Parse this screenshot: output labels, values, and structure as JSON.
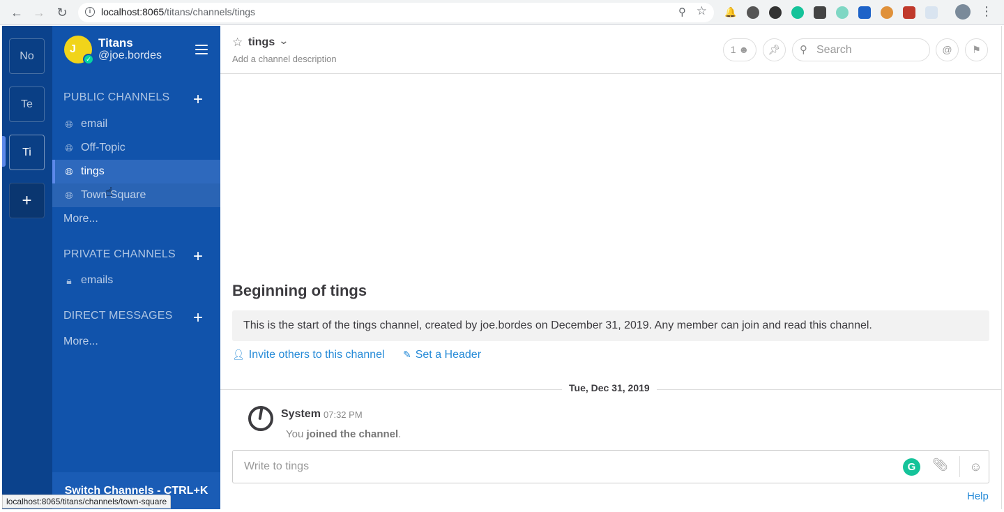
{
  "browser": {
    "url_host": "localhost:8065",
    "url_path": "/titans/channels/tings",
    "status_url": "localhost:8065/titans/channels/town-square"
  },
  "teams": [
    {
      "label": "No",
      "active": false
    },
    {
      "label": "Te",
      "active": false
    },
    {
      "label": "Ti",
      "active": true
    },
    {
      "label": "+",
      "active": false
    }
  ],
  "sidebar": {
    "avatar_initial": "J",
    "team_name": "Titans",
    "username": "@joe.bordes",
    "public_title": "PUBLIC CHANNELS",
    "public_channels": [
      {
        "label": "email",
        "active": false
      },
      {
        "label": "Off-Topic",
        "active": false
      },
      {
        "label": "tings",
        "active": true
      },
      {
        "label": "Town Square",
        "active": false
      }
    ],
    "public_more": "More...",
    "private_title": "PRIVATE CHANNELS",
    "private_channels": [
      {
        "label": "emails"
      }
    ],
    "dm_title": "DIRECT MESSAGES",
    "dm_more": "More...",
    "switch_label": "Switch Channels - CTRL+K"
  },
  "channel": {
    "name": "tings",
    "description_placeholder": "Add a channel description",
    "member_count": "1",
    "search_placeholder": "Search"
  },
  "intro": {
    "title": "Beginning of tings",
    "text": "This is the start of the tings channel, created by joe.bordes on December 31, 2019. Any member can join and read this channel.",
    "invite_label": "Invite others to this channel",
    "header_label": "Set a Header"
  },
  "posts": {
    "date_separator": "Tue, Dec 31, 2019",
    "items": [
      {
        "user": "System",
        "time": "07:32 PM",
        "prefix": "You",
        "message": "joined the channel",
        "suffix": "."
      }
    ]
  },
  "composer": {
    "placeholder": "Write to tings"
  },
  "footer": {
    "help": "Help"
  },
  "colors": {
    "team_bar": "#0b428c",
    "sidebar": "#1153ab",
    "active_channel": "#2e69bd",
    "link": "#2389d7",
    "online_status": "#06d6a0"
  }
}
